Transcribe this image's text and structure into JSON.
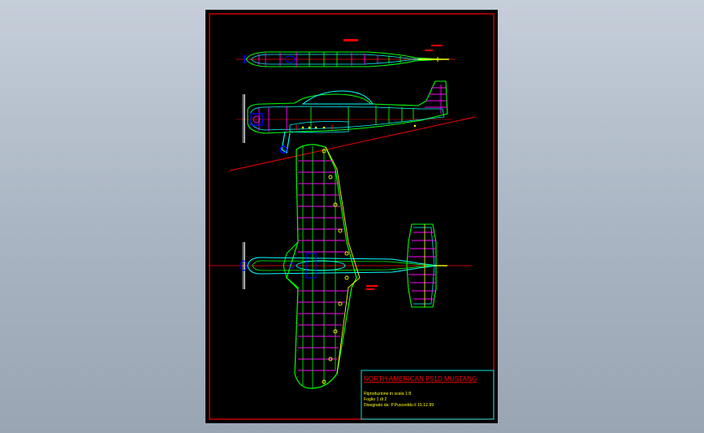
{
  "drawing": {
    "title": "NORTH AMERICAN P51D MUSTANG",
    "line1": "Riproduzione in scala 1:8",
    "line2": "Foglio 1 di 2",
    "line3": "Disegnato da: P.Pusceddu il 15.12.99"
  },
  "colors": {
    "background": "#a9b4c2",
    "sheet": "#000000",
    "border": "#ff0000",
    "structure": "#00ff00",
    "outline": "#00ffff",
    "ribs": "#ff00ff",
    "detail": "#0000ff",
    "hardware": "#ffff00",
    "lines": "#ffffff"
  }
}
